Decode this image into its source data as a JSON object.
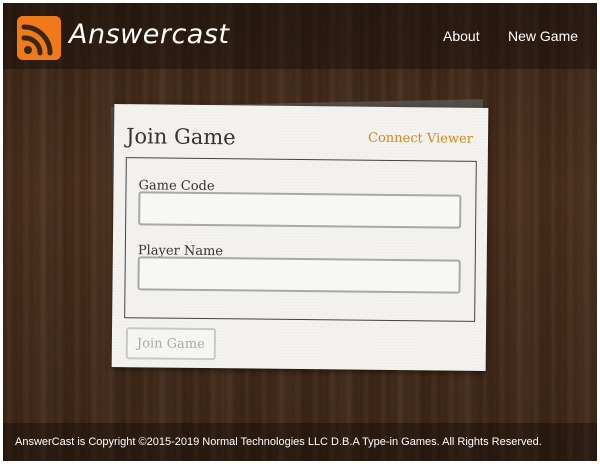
{
  "header": {
    "brand": "Answercast",
    "logo_icon": "rss-feed-icon",
    "nav": {
      "about": "About",
      "new_game": "New Game"
    }
  },
  "card": {
    "title": "Join Game",
    "connect_viewer": "Connect Viewer",
    "fields": {
      "game_code": {
        "label": "Game Code",
        "value": "",
        "placeholder": ""
      },
      "player_name": {
        "label": "Player Name",
        "value": "",
        "placeholder": ""
      }
    },
    "join_button": "Join Game"
  },
  "footer": {
    "text": "AnswerCast is Copyright ©2015-2019 Normal Technologies LLC D.B.A Type-in Games. All Rights Reserved."
  },
  "colors": {
    "accent_orange": "#f07a1a",
    "link_orange": "#d18a1e",
    "wood_dark": "#3b2516"
  }
}
